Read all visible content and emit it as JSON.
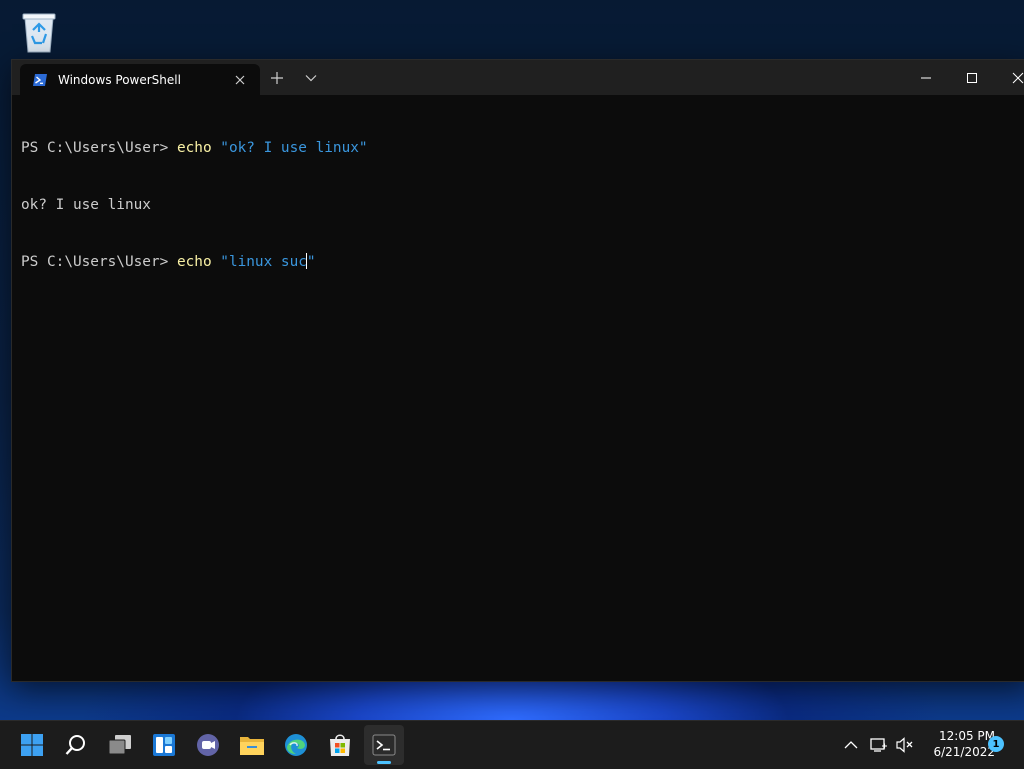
{
  "desktop": {
    "icons": [
      {
        "icon": "recycle-bin-icon"
      }
    ]
  },
  "window": {
    "tab_title": "Windows PowerShell",
    "tab_icon": "powershell-icon"
  },
  "console": {
    "lines": [
      {
        "prompt": "PS C:\\Users\\User> ",
        "command": "echo",
        "argument": "\"ok? I use linux\""
      },
      {
        "output": "ok? I use linux"
      },
      {
        "prompt": "PS C:\\Users\\User> ",
        "command": "echo",
        "argument_before_cursor": "\"linux suc",
        "argument_after_cursor": "\""
      }
    ]
  },
  "taskbar": {
    "apps": [
      "start-icon",
      "search-icon",
      "task-view-icon",
      "widgets-icon",
      "teams-chat-icon",
      "file-explorer-icon",
      "edge-icon",
      "store-icon",
      "terminal-icon"
    ],
    "active_app": "terminal-icon"
  },
  "tray": {
    "time": "12:05 PM",
    "date": "6/21/2022",
    "notification_count": "1"
  },
  "colors": {
    "console_bg": "#0c0c0c",
    "command": "#f9f1a5",
    "string": "#3a96dd",
    "accent": "#4cc2ff"
  }
}
